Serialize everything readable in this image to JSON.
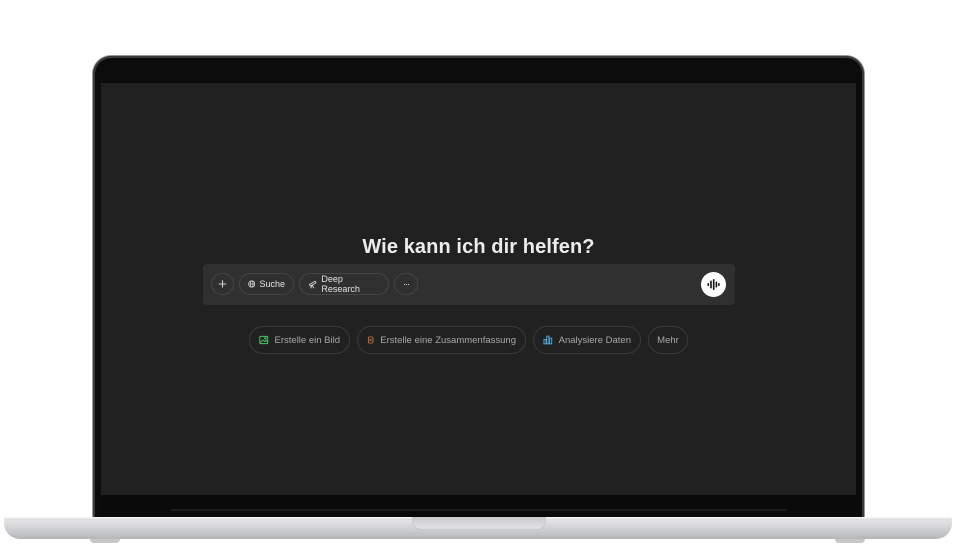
{
  "main": {
    "heading": "Wie kann ich dir helfen?"
  },
  "composer": {
    "tools": {
      "add_label": "+",
      "search_label": "Suche",
      "deep_research_label": "Deep Research",
      "more_label": "···"
    },
    "voice_icon": "voice-waveform-icon"
  },
  "suggestions": [
    {
      "label": "Erstelle ein Bild",
      "icon": "image-icon",
      "color": "#4ec26b"
    },
    {
      "label": "Erstelle eine Zusammenfassung",
      "icon": "document-icon",
      "color": "#e8894a"
    },
    {
      "label": "Analysiere Daten",
      "icon": "chart-icon",
      "color": "#53a9d9"
    },
    {
      "label": "Mehr"
    }
  ],
  "colors": {
    "screen_background": "#212121",
    "composer_background": "#303030",
    "heading_text": "#ececec"
  }
}
